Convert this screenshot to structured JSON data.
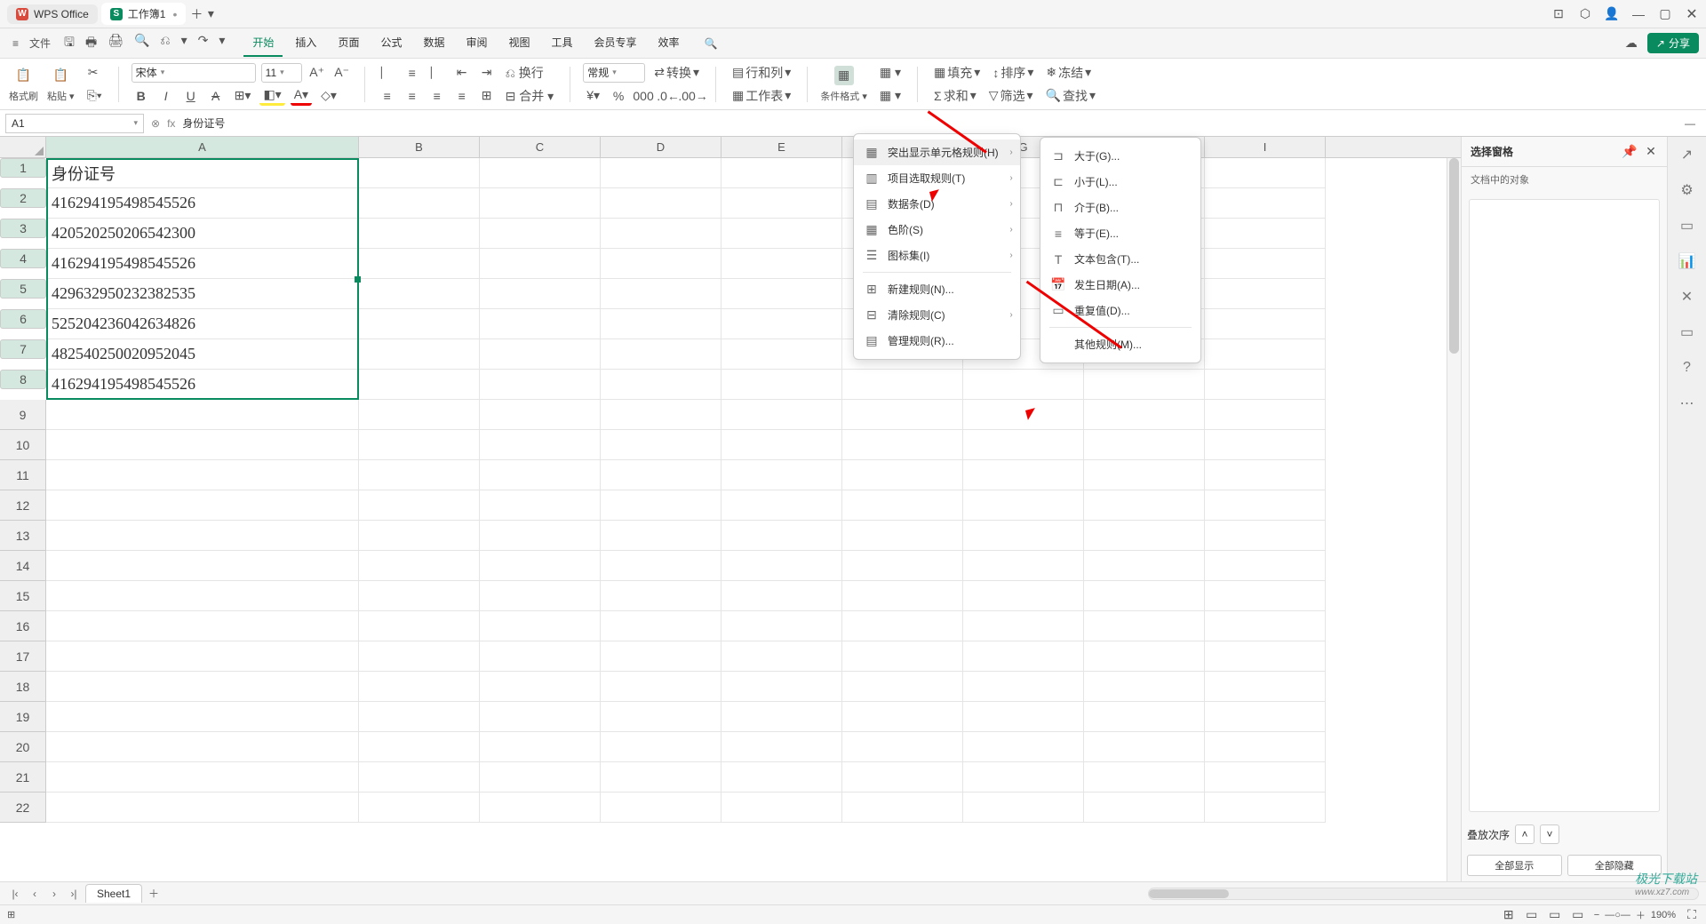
{
  "title": {
    "app": "WPS Office",
    "doc": "工作簿1"
  },
  "win_icons": [
    "⊡",
    "⬡",
    "👤",
    "—",
    "▢",
    "✕"
  ],
  "file_label": "文件",
  "qat_icons": [
    "🖫",
    "🖶",
    "🖨",
    "⎌",
    "▾",
    "↷",
    "▾"
  ],
  "menu_tabs": {
    "items": [
      "开始",
      "插入",
      "页面",
      "公式",
      "数据",
      "审阅",
      "视图",
      "工具",
      "会员专享",
      "效率"
    ],
    "active": 0
  },
  "top_right": {
    "cloud": "☁",
    "share": "分享"
  },
  "ribbon": {
    "format_painter": "格式刷",
    "paste": "粘贴",
    "font_name": "宋体",
    "font_size": "11",
    "number_format": "常规",
    "convert": "转换",
    "rows_cols": "行和列",
    "worksheet": "工作表",
    "cond_fmt": "条件格式",
    "fill": "填充",
    "sort": "排序",
    "freeze": "冻结",
    "sum": "求和",
    "filter": "筛选",
    "find": "查找"
  },
  "formula_bar": {
    "name": "A1",
    "fx": "fx",
    "value": "身份证号"
  },
  "columns": [
    "A",
    "B",
    "C",
    "D",
    "E",
    "F",
    "G",
    "H",
    "I"
  ],
  "col_a_header": "身份证号",
  "rows": [
    "416294195498545526",
    "420520250206542300",
    "416294195498545526",
    "429632950232382535",
    "525204236042634826",
    "482540250020952045",
    "416294195498545526"
  ],
  "row_count": 22,
  "menu1": [
    {
      "ic": "▦",
      "t": "突出显示单元格规则(H)",
      "sub": true,
      "hov": true
    },
    {
      "ic": "▥",
      "t": "项目选取规则(T)",
      "sub": true
    },
    {
      "ic": "▤",
      "t": "数据条(D)",
      "sub": true
    },
    {
      "ic": "▦",
      "t": "色阶(S)",
      "sub": true
    },
    {
      "ic": "☰",
      "t": "图标集(I)",
      "sub": true
    },
    {
      "ic": "⊞",
      "t": "新建规则(N)...",
      "sub": false
    },
    {
      "ic": "⊟",
      "t": "清除规则(C)",
      "sub": true
    },
    {
      "ic": "▤",
      "t": "管理规则(R)...",
      "sub": false
    }
  ],
  "menu2": [
    {
      "ic": "⊐",
      "t": "大于(G)..."
    },
    {
      "ic": "⊏",
      "t": "小于(L)..."
    },
    {
      "ic": "⊓",
      "t": "介于(B)..."
    },
    {
      "ic": "≡",
      "t": "等于(E)..."
    },
    {
      "ic": "T",
      "t": "文本包含(T)..."
    },
    {
      "ic": "📅",
      "t": "发生日期(A)..."
    },
    {
      "ic": "▭",
      "t": "重复值(D)..."
    },
    {
      "sep": true
    },
    {
      "t": "其他规则(M)..."
    }
  ],
  "sidepanel": {
    "title": "选择窗格",
    "sub": "文档中的对象",
    "order": "叠放次序",
    "show_all": "全部显示",
    "hide_all": "全部隐藏"
  },
  "sheet": {
    "name": "Sheet1"
  },
  "status": {
    "zoom": "190%"
  },
  "watermark": {
    "t1": "极光下载站",
    "t2": "www.xz7.com"
  }
}
